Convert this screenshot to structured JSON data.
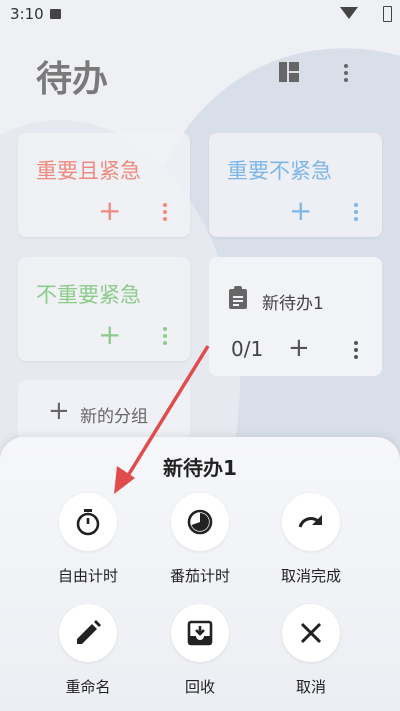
{
  "status_bar": {
    "time": "3:10"
  },
  "header": {
    "title": "待办"
  },
  "groups": [
    {
      "label": "重要且紧急",
      "color": "#ef8a80",
      "plus": "+"
    },
    {
      "label": "重要不紧急",
      "color": "#7db6ea",
      "plus": "+"
    },
    {
      "label": "不重要紧急",
      "color": "#8ccb8a",
      "plus": "+"
    }
  ],
  "task": {
    "title": "新待办1",
    "progress": "0/1",
    "plus": "+"
  },
  "new_group": {
    "plus": "+",
    "label": "新的分组"
  },
  "sheet": {
    "title": "新待办1",
    "actions": [
      {
        "label": "自由计时",
        "icon": "stopwatch-icon"
      },
      {
        "label": "番茄计时",
        "icon": "timer-icon"
      },
      {
        "label": "取消完成",
        "icon": "redo-icon"
      },
      {
        "label": "重命名",
        "icon": "pencil-icon"
      },
      {
        "label": "回收",
        "icon": "archive-icon"
      },
      {
        "label": "取消",
        "icon": "close-icon"
      }
    ]
  },
  "colors": {
    "accent_red": "#e04b4b",
    "text_dark": "#222222",
    "text_gray": "#666666"
  }
}
